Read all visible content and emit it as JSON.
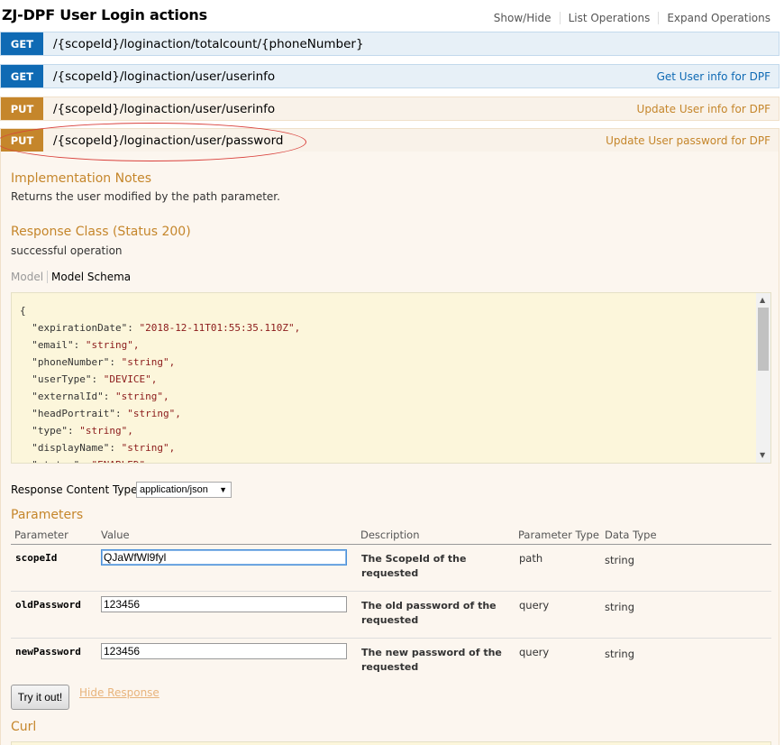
{
  "header": {
    "title": "ZJ-DPF User Login actions",
    "links": [
      "Show/Hide",
      "List Operations",
      "Expand Operations"
    ]
  },
  "operations": [
    {
      "method": "GET",
      "path": "/{scopeId}/loginaction/totalcount/{phoneNumber}",
      "summary": ""
    },
    {
      "method": "GET",
      "path": "/{scopeId}/loginaction/user/userinfo",
      "summary": "Get User info for DPF"
    },
    {
      "method": "PUT",
      "path": "/{scopeId}/loginaction/user/userinfo",
      "summary": "Update User info for DPF"
    },
    {
      "method": "PUT",
      "path": "/{scopeId}/loginaction/user/password",
      "summary": "Update User password for DPF"
    }
  ],
  "details": {
    "impl_heading": "Implementation Notes",
    "impl_text": "Returns the user modified by the path parameter.",
    "response_heading": "Response Class (Status 200)",
    "response_text": "successful operation",
    "model_tab": "Model",
    "schema_tab": "Model Schema",
    "schema_lines": [
      {
        "key": "{",
        "val": ""
      },
      {
        "key": "  \"expirationDate\": ",
        "val": "\"2018-12-11T01:55:35.110Z\","
      },
      {
        "key": "  \"email\": ",
        "val": "\"string\","
      },
      {
        "key": "  \"phoneNumber\": ",
        "val": "\"string\","
      },
      {
        "key": "  \"userType\": ",
        "val": "\"DEVICE\","
      },
      {
        "key": "  \"externalId\": ",
        "val": "\"string\","
      },
      {
        "key": "  \"headPortrait\": ",
        "val": "\"string\","
      },
      {
        "key": "  \"type\": ",
        "val": "\"string\","
      },
      {
        "key": "  \"displayName\": ",
        "val": "\"string\","
      },
      {
        "key": "  \"status\": ",
        "val": "\"ENABLED\","
      }
    ],
    "content_type_label": "Response Content Type",
    "content_type_value": "application/json",
    "params_heading": "Parameters",
    "params_columns": [
      "Parameter",
      "Value",
      "Description",
      "Parameter Type",
      "Data Type"
    ],
    "params": [
      {
        "name": "scopeId",
        "value": "QJaWfWl9fyl",
        "desc": "The ScopeId of the requested",
        "ptype": "path",
        "dtype": "string"
      },
      {
        "name": "oldPassword",
        "value": "123456",
        "desc": "The old password of the requested",
        "ptype": "query",
        "dtype": "string"
      },
      {
        "name": "newPassword",
        "value": "123456",
        "desc": "The new password of the requested",
        "ptype": "query",
        "dtype": "string"
      }
    ],
    "try_button": "Try it out!",
    "hide_response": "Hide Response",
    "curl_heading": "Curl"
  },
  "colors": {
    "get_accent": "#0f6ab4",
    "put_accent": "#c5862b",
    "annotation": "#d9413c"
  },
  "icons": {
    "select_caret": "▼",
    "scroll_up": "▲",
    "scroll_down": "▼"
  }
}
